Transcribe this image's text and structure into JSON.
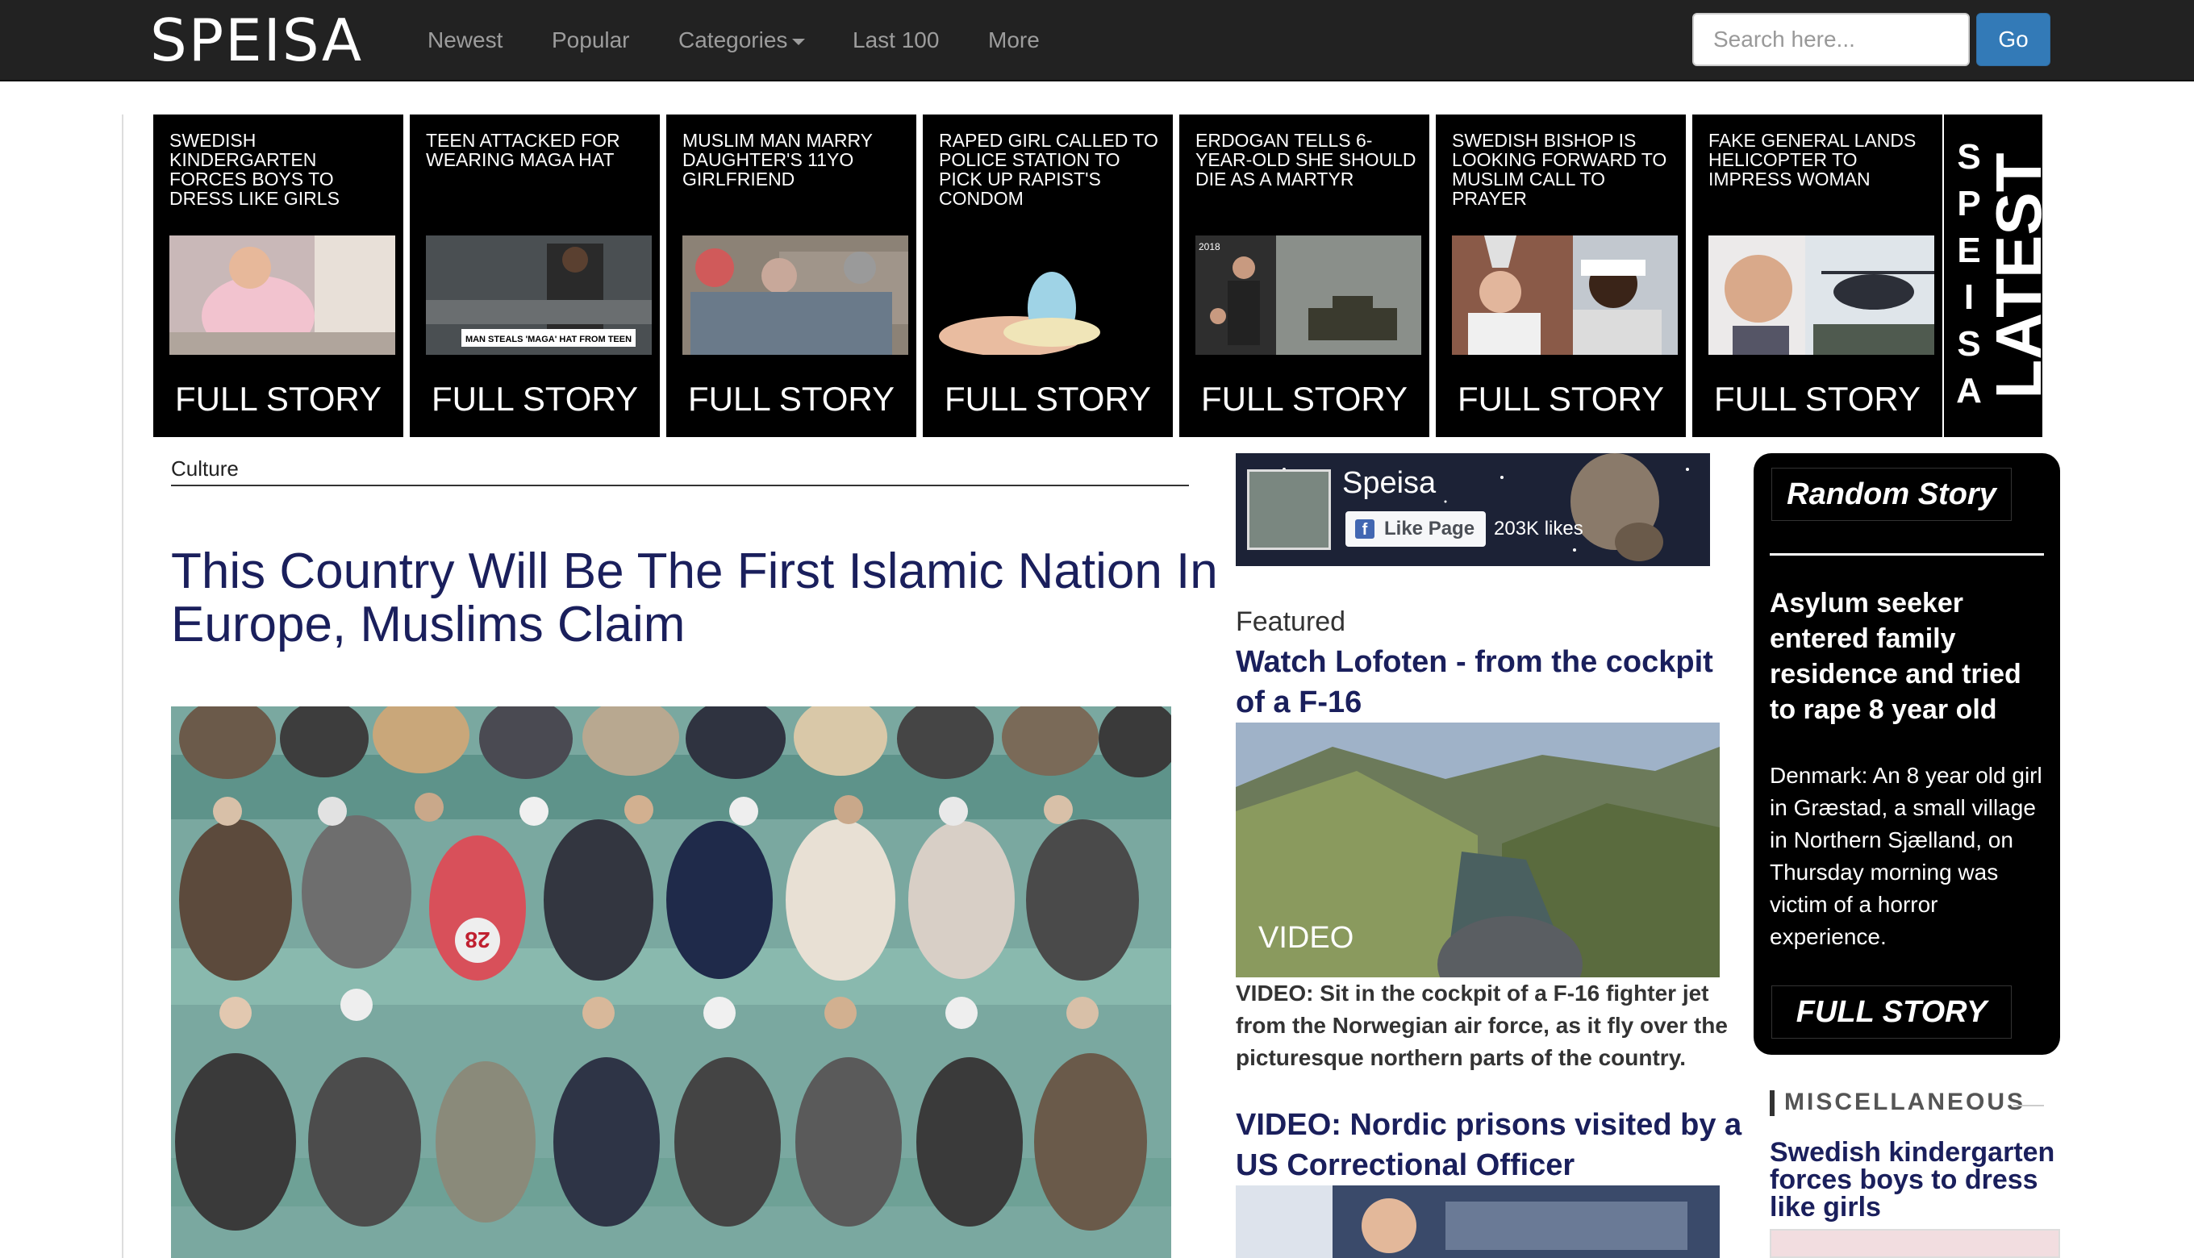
{
  "navbar": {
    "logo": "SPEISA",
    "items": [
      "Newest",
      "Popular",
      "Categories",
      "Last 100",
      "More"
    ],
    "search_placeholder": "Search here...",
    "go_label": "Go"
  },
  "latest_strip": {
    "cards": [
      {
        "title": "SWEDISH KINDERGARTEN FORCES BOYS TO DRESS LIKE GIRLS",
        "cta": "FULL STORY"
      },
      {
        "title": "TEEN ATTACKED FOR WEARING MAGA HAT",
        "cta": "FULL STORY",
        "image_caption": "MAN STEALS 'MAGA' HAT FROM TEEN"
      },
      {
        "title": "MUSLIM MAN MARRY DAUGHTER'S 11YO GIRLFRIEND",
        "cta": "FULL STORY"
      },
      {
        "title": "RAPED GIRL CALLED TO POLICE STATION TO PICK UP RAPIST'S CONDOM",
        "cta": "FULL STORY"
      },
      {
        "title": "ERDOGAN TELLS 6-YEAR-OLD SHE SHOULD DIE AS A MARTYR",
        "cta": "FULL STORY",
        "image_caption": "2018"
      },
      {
        "title": "SWEDISH BISHOP IS LOOKING FORWARD TO MUSLIM CALL TO PRAYER",
        "cta": "FULL STORY"
      },
      {
        "title": "FAKE GENERAL LANDS HELICOPTER TO IMPRESS WOMAN",
        "cta": "FULL STORY"
      }
    ],
    "side_brand": [
      "S",
      "P",
      "E",
      "I",
      "S",
      "A"
    ],
    "side_label": "LATEST"
  },
  "article": {
    "category": "Culture",
    "headline": "This Country Will Be The First Islamic Nation In Europe, Muslims Claim",
    "hero_shirt_number": "28"
  },
  "facebook": {
    "page_name": "Speisa",
    "like_label": "Like Page",
    "likes": "203K likes"
  },
  "featured": {
    "label": "Featured",
    "title": "Watch Lofoten - from the cockpit of a F-16",
    "video_tag": "VIDEO",
    "description": "VIDEO: Sit in the cockpit of a F-16 fighter jet from the Norwegian air force, as it fly over the picturesque northern parts of the country.",
    "second_title": "VIDEO: Nordic prisons visited by a US Correctional Officer"
  },
  "random_story": {
    "label": "Random Story",
    "title": "Asylum seeker entered family residence and tried to rape 8 year old",
    "description": "Denmark: An 8 year old girl in Græstad, a small village in Northern Sjælland, on Thursday morning was victim of a horror experience.",
    "cta": "FULL STORY"
  },
  "miscellaneous": {
    "label": "MISCELLANEOUS",
    "title": "Swedish kindergarten forces boys to dress like girls"
  },
  "colors": {
    "navbar_bg": "#222222",
    "accent_button": "#337ab7",
    "headline": "#1a1f5c"
  }
}
